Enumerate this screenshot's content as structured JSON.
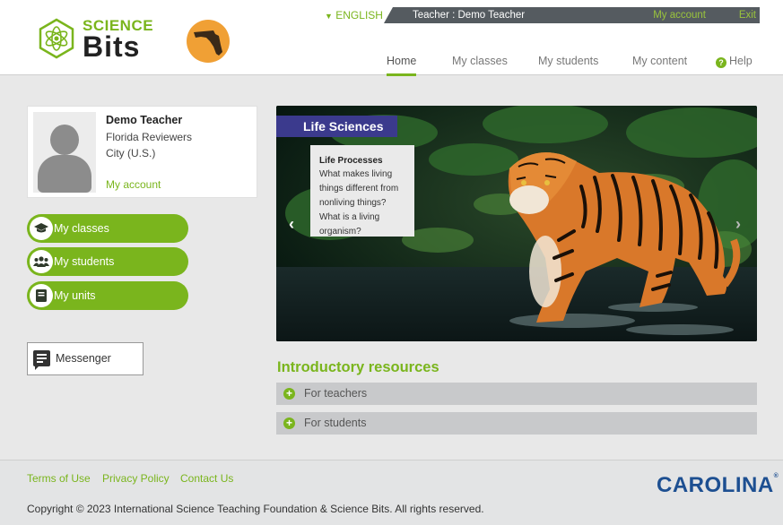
{
  "header": {
    "logo_top": "SCIENCE",
    "logo_bottom": "Bits",
    "language": "ENGLISH",
    "user": "Teacher : Demo Teacher",
    "my_account": "My account",
    "exit": "Exit",
    "nav": {
      "home": "Home",
      "classes": "My classes",
      "students": "My students",
      "content": "My content",
      "help": "Help"
    }
  },
  "profile": {
    "name": "Demo Teacher",
    "org": "Florida Reviewers",
    "city": "City (U.S.)",
    "account_link": "My account"
  },
  "sidebar": {
    "classes": "My classes",
    "students": "My students",
    "units": "My units",
    "messenger": "Messenger"
  },
  "hero": {
    "label": "Life Sciences",
    "card_title": "Life Processes",
    "card_text": "What makes living things different from nonliving things? What is a living organism?"
  },
  "intro": {
    "title": "Introductory resources",
    "teachers": "For teachers",
    "students": "For students"
  },
  "footer": {
    "terms": "Terms of Use",
    "privacy": "Privacy Policy",
    "contact": "Contact Us",
    "copyright": "Copyright © 2023 International Science Teaching Foundation & Science Bits. All rights reserved.",
    "carolina": "CAROLINA"
  },
  "colors": {
    "accent": "#7ab51d",
    "hero_label": "#3b3a8d",
    "topbar": "#555b60",
    "carolina_blue": "#1d4f91"
  }
}
